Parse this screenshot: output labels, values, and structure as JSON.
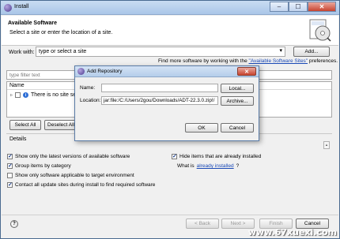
{
  "window": {
    "title": "Install",
    "minimize": "‒",
    "maximize": "☐",
    "close": "✕"
  },
  "header": {
    "title": "Available Software",
    "subtitle": "Select a site or enter the location of a site."
  },
  "workwith": {
    "label": "Work with:",
    "placeholder": "type or select a site",
    "add_button": "Add..."
  },
  "more_software": {
    "prefix": "Find more software by working with the ",
    "link": "\"Available Software Sites\"",
    "suffix": " preferences."
  },
  "filter": {
    "placeholder": "type filter text"
  },
  "table": {
    "column_name": "Name",
    "row_text": "There is no site sele"
  },
  "selection": {
    "select_all": "Select All",
    "deselect_all": "Deselect All"
  },
  "details": {
    "label": "Details"
  },
  "options": {
    "latest_versions": "Show only the latest versions of available software",
    "group_by_category": "Group items by category",
    "applicable_only": "Show only software applicable to target environment",
    "contact_all": "Contact all update sites during install to find required software",
    "hide_installed": "Hide items that are already installed",
    "what_is_prefix": "What is ",
    "what_is_link": "already installed",
    "what_is_suffix": "?"
  },
  "footer": {
    "back": "< Back",
    "next": "Next >",
    "finish": "Finish",
    "cancel": "Cancel"
  },
  "dialog": {
    "title": "Add Repository",
    "close": "✕",
    "name_label": "Name:",
    "name_value": "",
    "local_button": "Local...",
    "location_label": "Location:",
    "location_value": "jar:file:/C:/Users/2gou/Downloads/ADT-22.3.0.zip!/",
    "archive_button": "Archive...",
    "ok_button": "OK",
    "cancel_button": "Cancel"
  },
  "watermark": "www.67xuexi.com",
  "colors": {
    "link": "#1a49b6",
    "titlebar": "#b4cdea",
    "close": "#c8432f"
  },
  "icons": [
    "eclipse-icon",
    "install-cd-icon",
    "help-icon",
    "info-icon",
    "twisty-icon"
  ]
}
